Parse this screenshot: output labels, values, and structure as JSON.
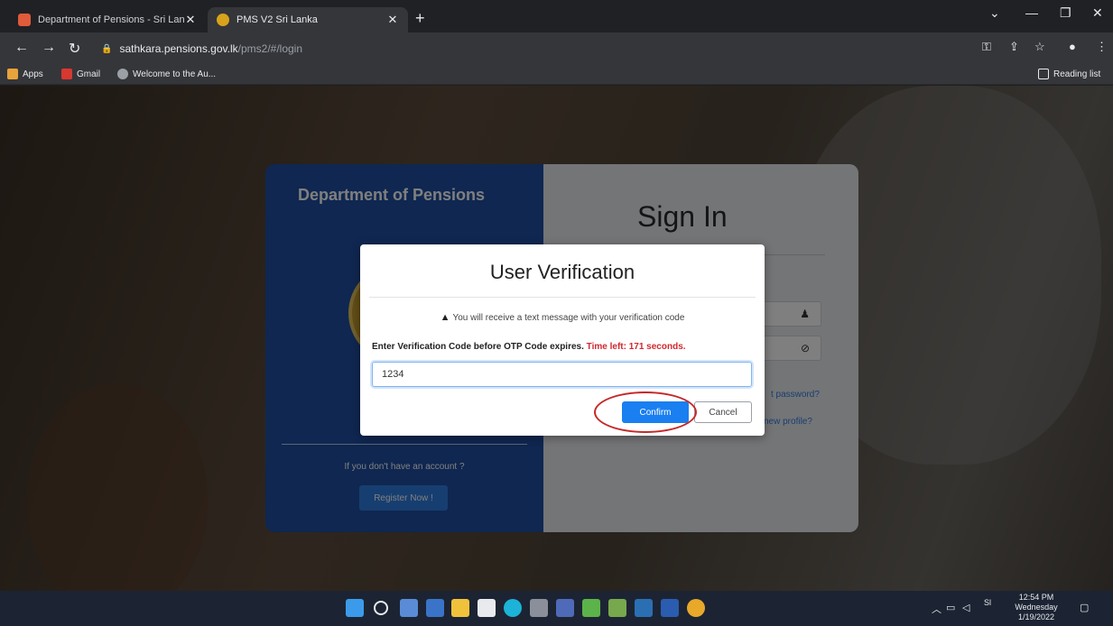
{
  "browser": {
    "tabs": [
      {
        "title": "Department of Pensions - Sri Lan",
        "active": false
      },
      {
        "title": "PMS V2 Sri Lanka",
        "active": true
      }
    ],
    "new_tab": "+",
    "url_host": "sathkara.pensions.gov.lk",
    "url_path": "/pms2/#/login",
    "bookmarks": [
      "Apps",
      "Gmail",
      "Welcome to the Au..."
    ],
    "reading_list": "Reading list"
  },
  "login_card": {
    "dept_title": "Department of Pensions",
    "signin_title": "Sign In",
    "forgot_link": "t password?",
    "new_profile_link": "new profile?",
    "no_account": "If you don't have an account ?",
    "register_button": "Register Now !"
  },
  "modal": {
    "title": "User Verification",
    "notice": "You will receive a text message with your verification code",
    "instruction": "Enter Verification Code before OTP Code expires.",
    "timer": "Time left: 171 seconds.",
    "otp_value": "1234",
    "confirm_label": "Confirm",
    "cancel_label": "Cancel"
  },
  "taskbar": {
    "time": "12:54 PM",
    "day": "Wednesday",
    "date": "1/19/2022",
    "lang": "Sl"
  },
  "colors": {
    "accent_blue": "#1a7ff0",
    "card_blue": "#1e4fa2",
    "timer_red": "#d0282e",
    "annotation_red": "#c62828"
  }
}
